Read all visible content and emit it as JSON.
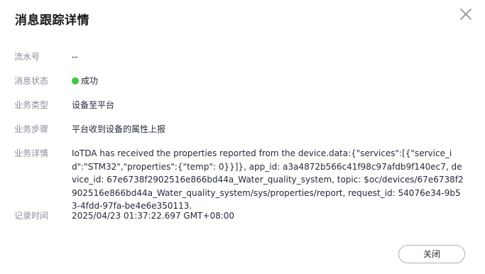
{
  "dialog": {
    "title": "消息跟踪详情",
    "close_label": "关闭"
  },
  "fields": {
    "serial": {
      "label": "流水号",
      "value": "--"
    },
    "status": {
      "label": "消息状态",
      "value": "成功",
      "color": "#3ec63e"
    },
    "type": {
      "label": "业务类型",
      "value": "设备至平台"
    },
    "step": {
      "label": "业务步骤",
      "value": "平台收到设备的属性上报"
    },
    "detail": {
      "label": "业务详情",
      "value": "IoTDA has received the properties reported from the device.data:{\"services\":[{\"service_id\":\"STM32\",\"properties\":{\"temp\": 0}}]}, app_id: a3a4872b566c41f98c97afdb9f140ec7, device_id: 67e6738f2902516e866bd44a_Water_quality_system, topic: $oc/devices/67e6738f2902516e866bd44a_Water_quality_system/sys/properties/report, request_id: 54076e34-9b53-4fdd-97fa-be4e6e350113."
    },
    "time": {
      "label": "记录时间",
      "value": "2025/04/23 01:37:22.697 GMT+08:00"
    }
  }
}
